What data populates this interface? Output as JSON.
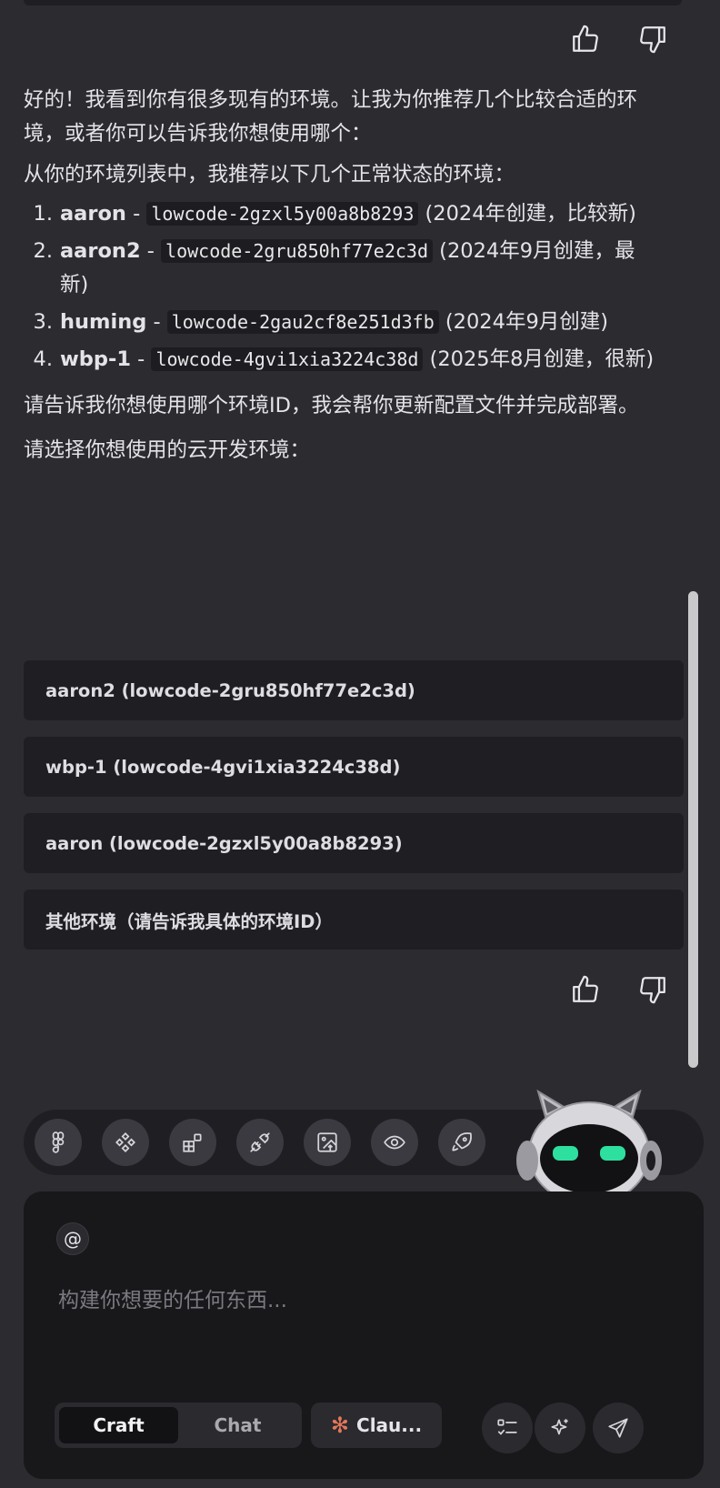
{
  "assistant_message": {
    "intro": "好的！我看到你有很多现有的环境。让我为你推荐几个比较合适的环境，或者你可以告诉我你想使用哪个：",
    "list_intro": "从你的环境列表中，我推荐以下几个正常状态的环境：",
    "environments": [
      {
        "number": "1.",
        "name": "aaron",
        "sep": " - ",
        "id": "lowcode-2gzxl5y00a8b8293",
        "note": " (2024年创建，比较新)"
      },
      {
        "number": "2.",
        "name": "aaron2",
        "sep": " - ",
        "id": "lowcode-2gru850hf77e2c3d",
        "note": " (2024年9月创建，最新)"
      },
      {
        "number": "3.",
        "name": "huming",
        "sep": " - ",
        "id": "lowcode-2gau2cf8e251d3fb",
        "note": " (2024年9月创建)"
      },
      {
        "number": "4.",
        "name": "wbp-1",
        "sep": " - ",
        "id": "lowcode-4gvi1xia3224c38d",
        "note": " (2025年8月创建，很新)"
      }
    ],
    "closing": "请告诉我你想使用哪个环境ID，我会帮你更新配置文件并完成部署。",
    "choose_prompt": "请选择你想使用的云开发环境："
  },
  "options": [
    {
      "label": "aaron2 (lowcode-2gru850hf77e2c3d)"
    },
    {
      "label": "wbp-1 (lowcode-4gvi1xia3224c38d)"
    },
    {
      "label": "aaron (lowcode-2gzxl5y00a8b8293)"
    },
    {
      "label": "其他环境（请告诉我具体的环境ID）"
    }
  ],
  "toolbar": {
    "icons": [
      "figma-icon",
      "component-icon",
      "blocks-icon",
      "plug-icon",
      "image-upload-icon",
      "eye-icon",
      "rocket-icon"
    ]
  },
  "composer": {
    "at_symbol": "@",
    "placeholder": "构建你想要的任何东西...",
    "modes": [
      {
        "label": "Craft",
        "active": true
      },
      {
        "label": "Chat",
        "active": false
      }
    ],
    "model_label": "Clau...",
    "model_icon": "✻"
  },
  "colors": {
    "background": "#2b2b30",
    "card": "#1f1f23",
    "composer": "#18181b",
    "accent_green": "#2de0a0",
    "claude_orange": "#e4775a"
  }
}
